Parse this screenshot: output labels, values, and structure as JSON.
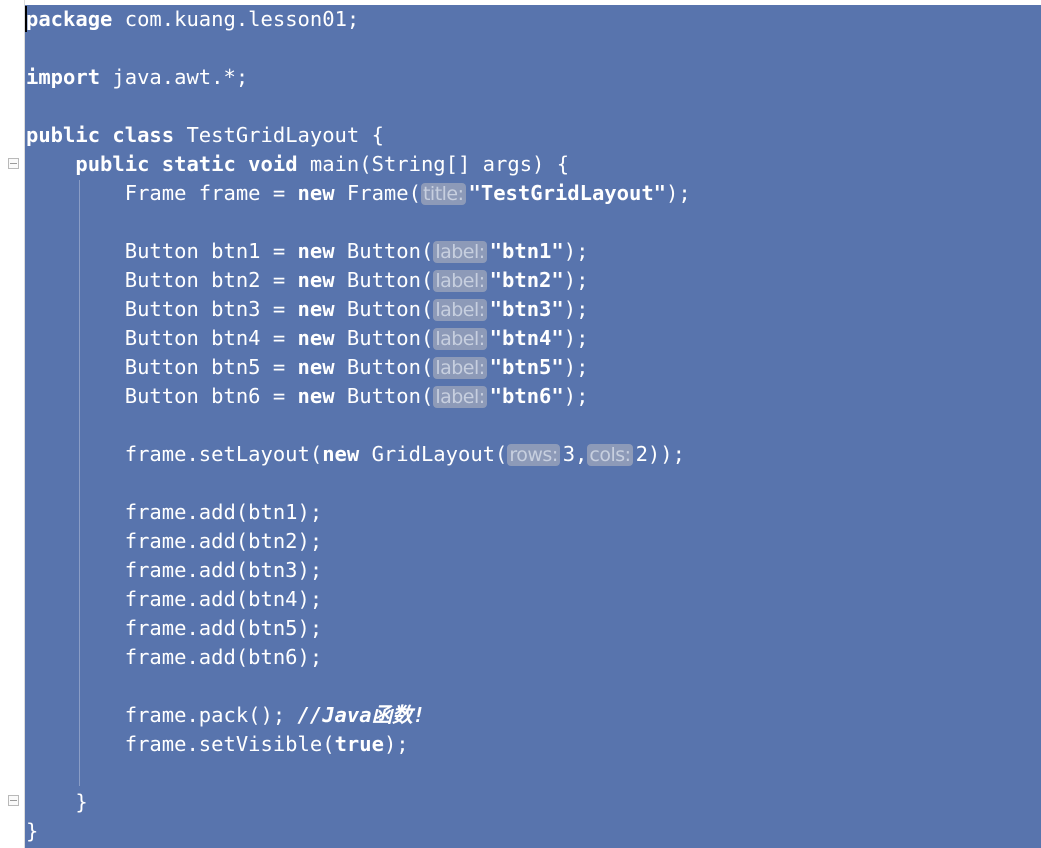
{
  "editor": {
    "lines": [
      [
        {
          "t": "kw",
          "v": "package"
        },
        {
          "t": "tx",
          "v": " com.kuang.lesson01;"
        }
      ],
      [],
      [
        {
          "t": "kw",
          "v": "import"
        },
        {
          "t": "tx",
          "v": " java.awt.*;"
        }
      ],
      [],
      [
        {
          "t": "kw",
          "v": "public class"
        },
        {
          "t": "tx",
          "v": " TestGridLayout {"
        }
      ],
      [
        {
          "t": "tx",
          "v": "    "
        },
        {
          "t": "kw",
          "v": "public static void"
        },
        {
          "t": "tx",
          "v": " main(String[] args) {"
        }
      ],
      [
        {
          "t": "tx",
          "v": "        Frame frame = "
        },
        {
          "t": "kw",
          "v": "new"
        },
        {
          "t": "tx",
          "v": " Frame("
        },
        {
          "t": "hint",
          "v": "title:"
        },
        {
          "t": "str",
          "v": "\"TestGridLayout\""
        },
        {
          "t": "tx",
          "v": ");"
        }
      ],
      [],
      [
        {
          "t": "tx",
          "v": "        Button btn1 = "
        },
        {
          "t": "kw",
          "v": "new"
        },
        {
          "t": "tx",
          "v": " Button("
        },
        {
          "t": "hint",
          "v": "label:"
        },
        {
          "t": "str",
          "v": "\"btn1\""
        },
        {
          "t": "tx",
          "v": ");"
        }
      ],
      [
        {
          "t": "tx",
          "v": "        Button btn2 = "
        },
        {
          "t": "kw",
          "v": "new"
        },
        {
          "t": "tx",
          "v": " Button("
        },
        {
          "t": "hint",
          "v": "label:"
        },
        {
          "t": "str",
          "v": "\"btn2\""
        },
        {
          "t": "tx",
          "v": ");"
        }
      ],
      [
        {
          "t": "tx",
          "v": "        Button btn3 = "
        },
        {
          "t": "kw",
          "v": "new"
        },
        {
          "t": "tx",
          "v": " Button("
        },
        {
          "t": "hint",
          "v": "label:"
        },
        {
          "t": "str",
          "v": "\"btn3\""
        },
        {
          "t": "tx",
          "v": ");"
        }
      ],
      [
        {
          "t": "tx",
          "v": "        Button btn4 = "
        },
        {
          "t": "kw",
          "v": "new"
        },
        {
          "t": "tx",
          "v": " Button("
        },
        {
          "t": "hint",
          "v": "label:"
        },
        {
          "t": "str",
          "v": "\"btn4\""
        },
        {
          "t": "tx",
          "v": ");"
        }
      ],
      [
        {
          "t": "tx",
          "v": "        Button btn5 = "
        },
        {
          "t": "kw",
          "v": "new"
        },
        {
          "t": "tx",
          "v": " Button("
        },
        {
          "t": "hint",
          "v": "label:"
        },
        {
          "t": "str",
          "v": "\"btn5\""
        },
        {
          "t": "tx",
          "v": ");"
        }
      ],
      [
        {
          "t": "tx",
          "v": "        Button btn6 = "
        },
        {
          "t": "kw",
          "v": "new"
        },
        {
          "t": "tx",
          "v": " Button("
        },
        {
          "t": "hint",
          "v": "label:"
        },
        {
          "t": "str",
          "v": "\"btn6\""
        },
        {
          "t": "tx",
          "v": ");"
        }
      ],
      [],
      [
        {
          "t": "tx",
          "v": "        frame.setLayout("
        },
        {
          "t": "kw",
          "v": "new"
        },
        {
          "t": "tx",
          "v": " GridLayout("
        },
        {
          "t": "hint",
          "v": "rows:"
        },
        {
          "t": "tx",
          "v": "3,"
        },
        {
          "t": "hint",
          "v": "cols:"
        },
        {
          "t": "tx",
          "v": "2));"
        }
      ],
      [],
      [
        {
          "t": "tx",
          "v": "        frame.add(btn1);"
        }
      ],
      [
        {
          "t": "tx",
          "v": "        frame.add(btn2);"
        }
      ],
      [
        {
          "t": "tx",
          "v": "        frame.add(btn3);"
        }
      ],
      [
        {
          "t": "tx",
          "v": "        frame.add(btn4);"
        }
      ],
      [
        {
          "t": "tx",
          "v": "        frame.add(btn5);"
        }
      ],
      [
        {
          "t": "tx",
          "v": "        frame.add(btn6);"
        }
      ],
      [],
      [
        {
          "t": "tx",
          "v": "        frame.pack(); "
        },
        {
          "t": "cm",
          "v": "//Java函数!"
        }
      ],
      [
        {
          "t": "tx",
          "v": "        frame.setVisible("
        },
        {
          "t": "kw",
          "v": "true"
        },
        {
          "t": "tx",
          "v": ");"
        }
      ],
      [],
      [
        {
          "t": "tx",
          "v": "    }"
        }
      ],
      [
        {
          "t": "tx",
          "v": "}"
        }
      ]
    ]
  },
  "colors": {
    "selection": "#5874ad",
    "inlay_hint_bg": "#8d9ab8",
    "text": "#ffffff"
  }
}
